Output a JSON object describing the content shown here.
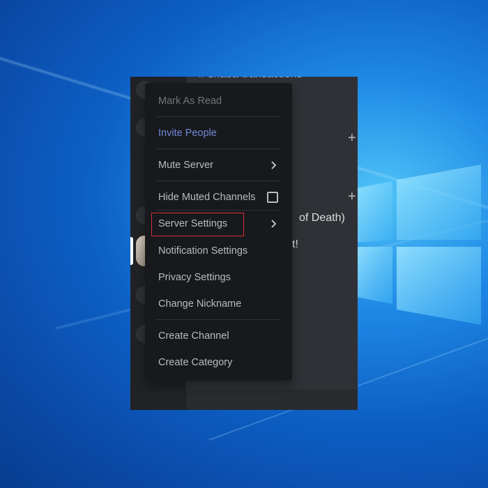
{
  "background_channel": {
    "title": "shaba-transactions",
    "partial_text_1": "of Death)",
    "partial_text_2": "t!",
    "add_symbol": "+"
  },
  "menu": {
    "items": [
      {
        "label": "Mark As Read",
        "state": "disabled"
      },
      {
        "label": "Invite People",
        "state": "accent"
      },
      {
        "label": "Mute Server",
        "submenu": true
      },
      {
        "label": "Hide Muted Channels",
        "checkbox": true,
        "checked": false
      },
      {
        "label": "Server Settings",
        "submenu": true,
        "highlighted": true
      },
      {
        "label": "Notification Settings"
      },
      {
        "label": "Privacy Settings"
      },
      {
        "label": "Change Nickname"
      },
      {
        "label": "Create Channel"
      },
      {
        "label": "Create Category"
      }
    ]
  },
  "colors": {
    "accent": "#7289da",
    "highlight_border": "#d1303a",
    "menu_bg": "#18191c",
    "desktop_blue": "#1e88e5"
  },
  "icons": {
    "channel": "hash-icon",
    "submenu": "chevron-right-icon",
    "checkbox": "checkbox-icon",
    "add": "plus-icon",
    "os": "windows-logo-icon"
  }
}
